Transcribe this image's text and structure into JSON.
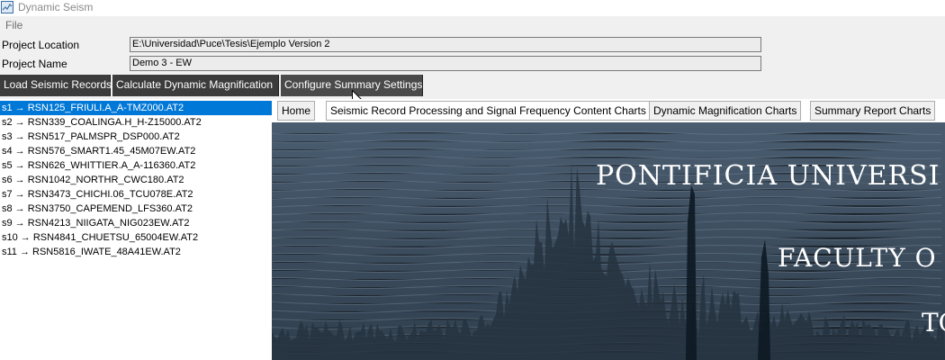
{
  "window": {
    "title": "Dynamic Seism"
  },
  "menu": {
    "file": "File"
  },
  "project": {
    "location_label": "Project Location",
    "location_value": "E:\\Universidad\\Puce\\Tesis\\Ejemplo Version 2",
    "name_label": "Project Name",
    "name_value": "Demo 3 - EW"
  },
  "toolbar": {
    "load": "Load Seismic Records",
    "calc": "Calculate Dynamic Magnification",
    "config": "Configure Summary Settings"
  },
  "records": [
    "s1 → RSN125_FRIULI.A_A-TMZ000.AT2",
    "s2 → RSN339_COALINGA.H_H-Z15000.AT2",
    "s3 → RSN517_PALMSPR_DSP000.AT2",
    "s4 → RSN576_SMART1.45_45M07EW.AT2",
    "s5 → RSN626_WHITTIER.A_A-116360.AT2",
    "s6 → RSN1042_NORTHR_CWC180.AT2",
    "s7 → RSN3473_CHICHI.06_TCU078E.AT2",
    "s8 → RSN3750_CAPEMEND_LFS360.AT2",
    "s9 → RSN4213_NIIGATA_NIG023EW.AT2",
    "s10 → RSN4841_CHUETSU_65004EW.AT2",
    "s11 → RSN5816_IWATE_48A41EW.AT2"
  ],
  "tabs": {
    "home": "Home",
    "processing": "Seismic Record Processing and Signal Frequency Content Charts",
    "magnification": "Dynamic Magnification Charts",
    "summary": "Summary Report Charts"
  },
  "banner": {
    "line1": "PONTIFICIA UNIVERSI",
    "line2": "FACULTY O",
    "line3": "TC"
  },
  "colors": {
    "selection": "#0078d7",
    "toolbar_bg": "#3c3c3c",
    "banner_bg": "#3f5163"
  }
}
